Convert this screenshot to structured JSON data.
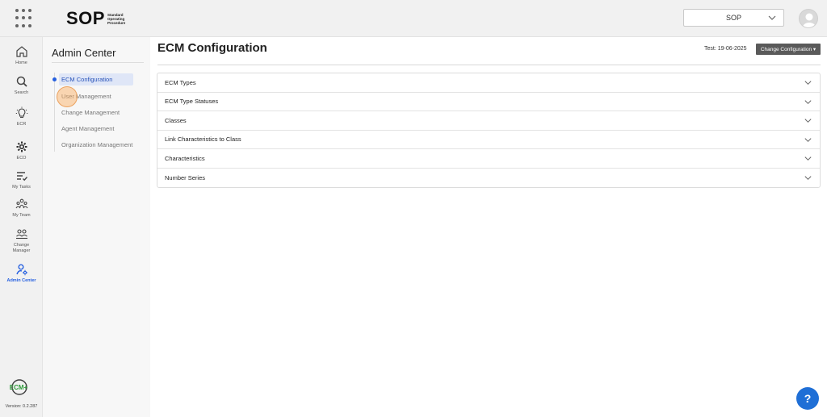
{
  "header": {
    "logo_text": "SOP",
    "logo_sub": [
      "Standard",
      "Operating",
      "Procedure"
    ],
    "org_select_value": "SOP",
    "grid_icon": "apps-grid-icon",
    "avatar_icon": "user-avatar-icon"
  },
  "rail": {
    "items": [
      {
        "label": "Home",
        "icon": "home-icon"
      },
      {
        "label": "Search",
        "icon": "search-icon"
      },
      {
        "label": "ECR",
        "icon": "lightbulb-icon"
      },
      {
        "label": "ECO",
        "icon": "gear-icon"
      },
      {
        "label": "My Tasks",
        "icon": "tasks-icon"
      },
      {
        "label": "My Team",
        "icon": "team-icon"
      },
      {
        "label": "Change\nManager",
        "icon": "change-manager-icon"
      },
      {
        "label": "Admin Center",
        "icon": "admin-icon"
      }
    ],
    "ecm_logo": "ECM+",
    "version": "Version: 0.2.287"
  },
  "subpanel": {
    "title": "Admin Center",
    "items": [
      {
        "label": "ECM Configuration"
      },
      {
        "label": "User Management"
      },
      {
        "label": "Change Management"
      },
      {
        "label": "Agent Management"
      },
      {
        "label": "Organization Management"
      }
    ]
  },
  "main": {
    "title": "ECM Configuration",
    "test_label": "Test: 19-06-2025",
    "change_config_label": "Change Configuration ▾",
    "sections": [
      {
        "label": "ECM Types"
      },
      {
        "label": "ECM Type Statuses"
      },
      {
        "label": "Classes"
      },
      {
        "label": "Link Characteristics to Class"
      },
      {
        "label": "Characteristics"
      },
      {
        "label": "Number Series"
      }
    ]
  },
  "help": {
    "label": "?"
  },
  "colors": {
    "accent": "#2660e0",
    "help": "#1f6fd6",
    "button_dark": "#5a5a5a"
  }
}
